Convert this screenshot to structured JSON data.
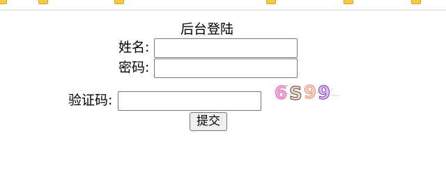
{
  "form": {
    "title": "后台登陆",
    "name_label": "姓名:",
    "name_value": "",
    "password_label": "密码:",
    "password_value": "",
    "captcha_label": "验证码:",
    "captcha_value": "",
    "captcha_image_text": "6S99",
    "submit_label": "提交"
  },
  "bookmarks_bar": {
    "folder_icon": "folder-icon",
    "folder_color": "#f7c948"
  }
}
